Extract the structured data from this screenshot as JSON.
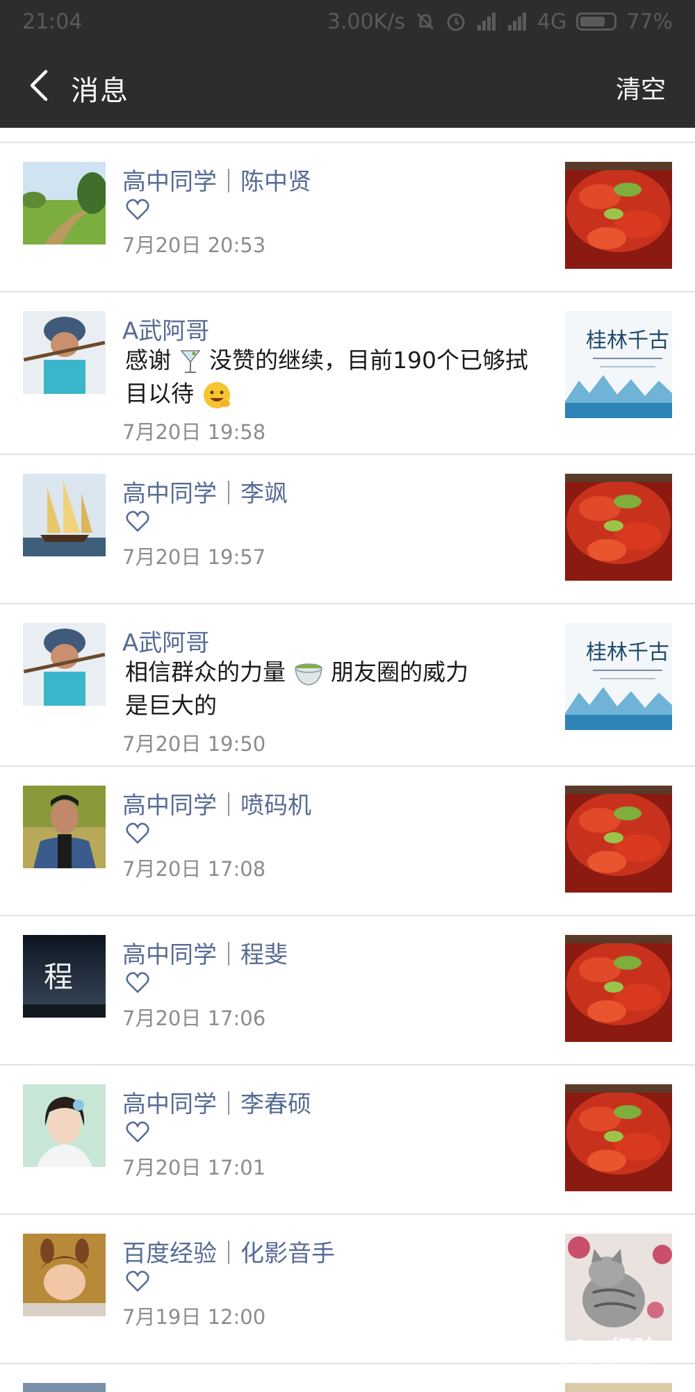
{
  "status_bar": {
    "time": "21:04",
    "network_speed": "3.00K/s",
    "network_type": "4G",
    "battery_percent": "77%",
    "battery_level": 0.77,
    "icons": [
      "mute-bell-icon",
      "alarm-icon",
      "signal-icon",
      "signal-icon",
      "battery-icon"
    ]
  },
  "header": {
    "back_icon": "chevron-left-icon",
    "title": "消息",
    "clear_label": "清空"
  },
  "messages": [
    {
      "name": "高中同学｜陈中贤",
      "type": "like",
      "time": "7月20日 20:53",
      "avatar": "landscape-path",
      "thumb": "crayfish-dish"
    },
    {
      "name": "A武阿哥",
      "type": "comment",
      "comment_part1": "感谢",
      "comment_part2": "没赞的继续，目前190个已够拭目以待",
      "time": "7月20日 19:58",
      "avatar": "flute-player",
      "thumb": "guilin-poster"
    },
    {
      "name": "高中同学｜李飒",
      "type": "like",
      "time": "7月20日 19:57",
      "avatar": "sailing-ship",
      "thumb": "crayfish-dish"
    },
    {
      "name": "A武阿哥",
      "type": "comment",
      "comment_part1": "相信群众的力量",
      "comment_part2": "朋友圈的威力是巨大的",
      "time": "7月20日 19:50",
      "avatar": "flute-player",
      "thumb": "guilin-poster"
    },
    {
      "name": "高中同学｜喷码机",
      "type": "like",
      "time": "7月20日 17:08",
      "avatar": "young-man",
      "thumb": "crayfish-dish"
    },
    {
      "name": "高中同学｜程斐",
      "type": "like",
      "time": "7月20日 17:06",
      "avatar": "cheng-character",
      "avatar_text": "程",
      "thumb": "crayfish-dish"
    },
    {
      "name": "高中同学｜李春硕",
      "type": "like",
      "time": "7月20日 17:01",
      "avatar": "girl-portrait",
      "thumb": "crayfish-dish"
    },
    {
      "name": "百度经验｜化影音手",
      "type": "like",
      "time": "7月19日 12:00",
      "avatar": "baby-costume",
      "thumb": "cat-photo"
    }
  ],
  "thumb_text": {
    "guilin_title": "桂林千古"
  },
  "watermark": {
    "logo": "Bai du 经验",
    "url": "jingyan.baidu.com"
  },
  "colors": {
    "bar_bg": "#2d2d2d",
    "name_color": "#576b95",
    "time_color": "#8c8c8c",
    "divider": "#e2e2e2"
  }
}
